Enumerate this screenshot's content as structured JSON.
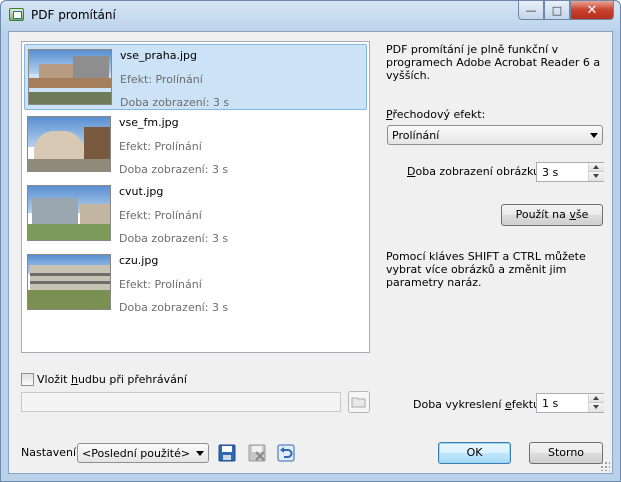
{
  "window": {
    "title": "PDF promítání",
    "minimize": "—",
    "maximize": "□",
    "close": "✕"
  },
  "images": [
    {
      "name": "vse_praha.jpg",
      "effect": "Efekt: Prolínání",
      "duration": "Doba zobrazení: 3 s",
      "selected": true
    },
    {
      "name": "vse_fm.jpg",
      "effect": "Efekt: Prolínání",
      "duration": "Doba zobrazení: 3 s",
      "selected": false
    },
    {
      "name": "cvut.jpg",
      "effect": "Efekt: Prolínání",
      "duration": "Doba zobrazení: 3 s",
      "selected": false
    },
    {
      "name": "czu.jpg",
      "effect": "Efekt: Prolínání",
      "duration": "Doba zobrazení: 3 s",
      "selected": false
    }
  ],
  "right": {
    "info": "PDF promítání je plně funkční v programech Adobe Acrobat Reader 6 a vyšších.",
    "effect_label_pre": "",
    "effect_label_acc": "P",
    "effect_label_post": "řechodový efekt:",
    "effect_value": "Prolínání",
    "display_label_pre": "",
    "display_label_acc": "D",
    "display_label_post": "oba zobrazení obrázku:",
    "display_value": "3 s",
    "apply_all_pre": "Použít na ",
    "apply_all_acc": "v",
    "apply_all_post": "še",
    "hint": "Pomocí kláves SHIFT a CTRL můžete vybrat více obrázků a změnit jim parametry naráz."
  },
  "music": {
    "checkbox_pre": "Vložit ",
    "checkbox_acc": "h",
    "checkbox_post": "udbu při přehrávání",
    "checked": false,
    "path": ""
  },
  "render": {
    "label_pre": "Doba vykreslení ",
    "label_acc": "e",
    "label_post": "fektu:",
    "value": "1 s"
  },
  "footer": {
    "settings_label": "Nastavení:",
    "settings_value": "<Poslední použité>",
    "ok": "OK",
    "cancel": "Storno"
  }
}
